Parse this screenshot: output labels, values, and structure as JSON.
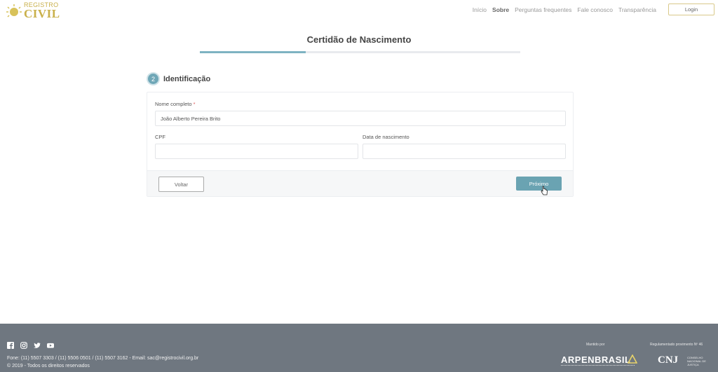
{
  "header": {
    "logo_top": "REGISTRO",
    "logo_main": "CIVIL",
    "nav": [
      {
        "label": "Início",
        "active": false
      },
      {
        "label": "Sobre",
        "active": true
      },
      {
        "label": "Perguntas frequentes",
        "active": false
      },
      {
        "label": "Fale conosco",
        "active": false
      },
      {
        "label": "Transparência",
        "active": false
      }
    ],
    "login_label": "Login"
  },
  "page": {
    "title": "Certidão de Nascimento",
    "progress_fraction": 0.33
  },
  "step": {
    "number": "2",
    "title": "Identificação"
  },
  "form": {
    "name_label": "Nome completo",
    "name_required_mark": "*",
    "name_value": "João Alberto Pereira Brito",
    "cpf_label": "CPF",
    "cpf_value": "",
    "birth_label": "Data de nascimento",
    "birth_value": "",
    "back_label": "Voltar",
    "next_label": "Próximo"
  },
  "footer": {
    "social_icons": [
      "facebook-icon",
      "instagram-icon",
      "twitter-icon",
      "youtube-icon"
    ],
    "contact": "Fone: (11) 5507 3303 / (11) 5506 0501 / (11) 5507 3162 - Email: sac@registrocivil.org.br",
    "rights": "© 2019 - Todos os direitos reservados",
    "maintained_by": "Mantido por",
    "regulation": "Regulamentado provimento Nº 46",
    "arpen_logo": "ARPENBRASIL",
    "cnj_logo": "CNJ",
    "cnj_text": "CONSELHO NACIONAL DE JUSTIÇA"
  },
  "colors": {
    "accent": "#6aa3b2",
    "footer_bg": "#6f7780",
    "logo_gold": "#c9b04a"
  }
}
